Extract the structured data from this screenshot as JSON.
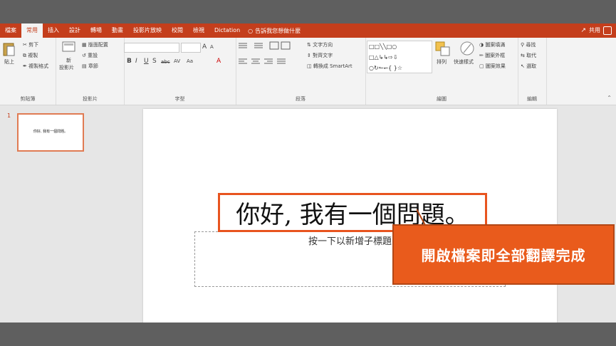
{
  "ribbon": {
    "tabs": [
      "檔案",
      "常用",
      "插入",
      "設計",
      "轉場",
      "動畫",
      "投影片放映",
      "校閱",
      "檢視",
      "Dictation"
    ],
    "active_tab": "常用",
    "tell_me": "告訴我您想做什麼",
    "share": "共用"
  },
  "clipboard": {
    "paste": "貼上",
    "cut": "剪下",
    "copy": "複製",
    "format_painter": "複製格式",
    "label": "剪貼簿"
  },
  "slides_group": {
    "new_slide_1": "新",
    "new_slide_2": "投影片",
    "layout": "版面配置",
    "reset": "重設",
    "section": "章節",
    "label": "投影片"
  },
  "font_group": {
    "label": "字型",
    "bold": "B",
    "italic": "I",
    "underline": "U",
    "shadow": "S",
    "strike": "abc",
    "spacing": "AV",
    "case": "Aa",
    "font_color": "A",
    "grow": "A",
    "shrink": "A"
  },
  "para_group": {
    "label": "段落",
    "text_direction": "文字方向",
    "align_text": "對齊文字",
    "smartart": "轉換成 SmartArt"
  },
  "draw_group": {
    "label": "繪圖",
    "arrange": "排列",
    "quick_styles": "快速樣式",
    "fill": "圖案填滿",
    "outline": "圖案外框",
    "effects": "圖案效果"
  },
  "edit_group": {
    "label": "編輯",
    "find": "尋找",
    "replace": "取代",
    "select": "選取"
  },
  "pane": {
    "slide_number": "1",
    "thumb_text": "你好, 我有一個問題。"
  },
  "slide": {
    "title": "你好, 我有一個問題。",
    "subtitle_placeholder": "按一下以新增子標題"
  },
  "callout": {
    "text": "開啟檔案即全部翻譯完成"
  }
}
